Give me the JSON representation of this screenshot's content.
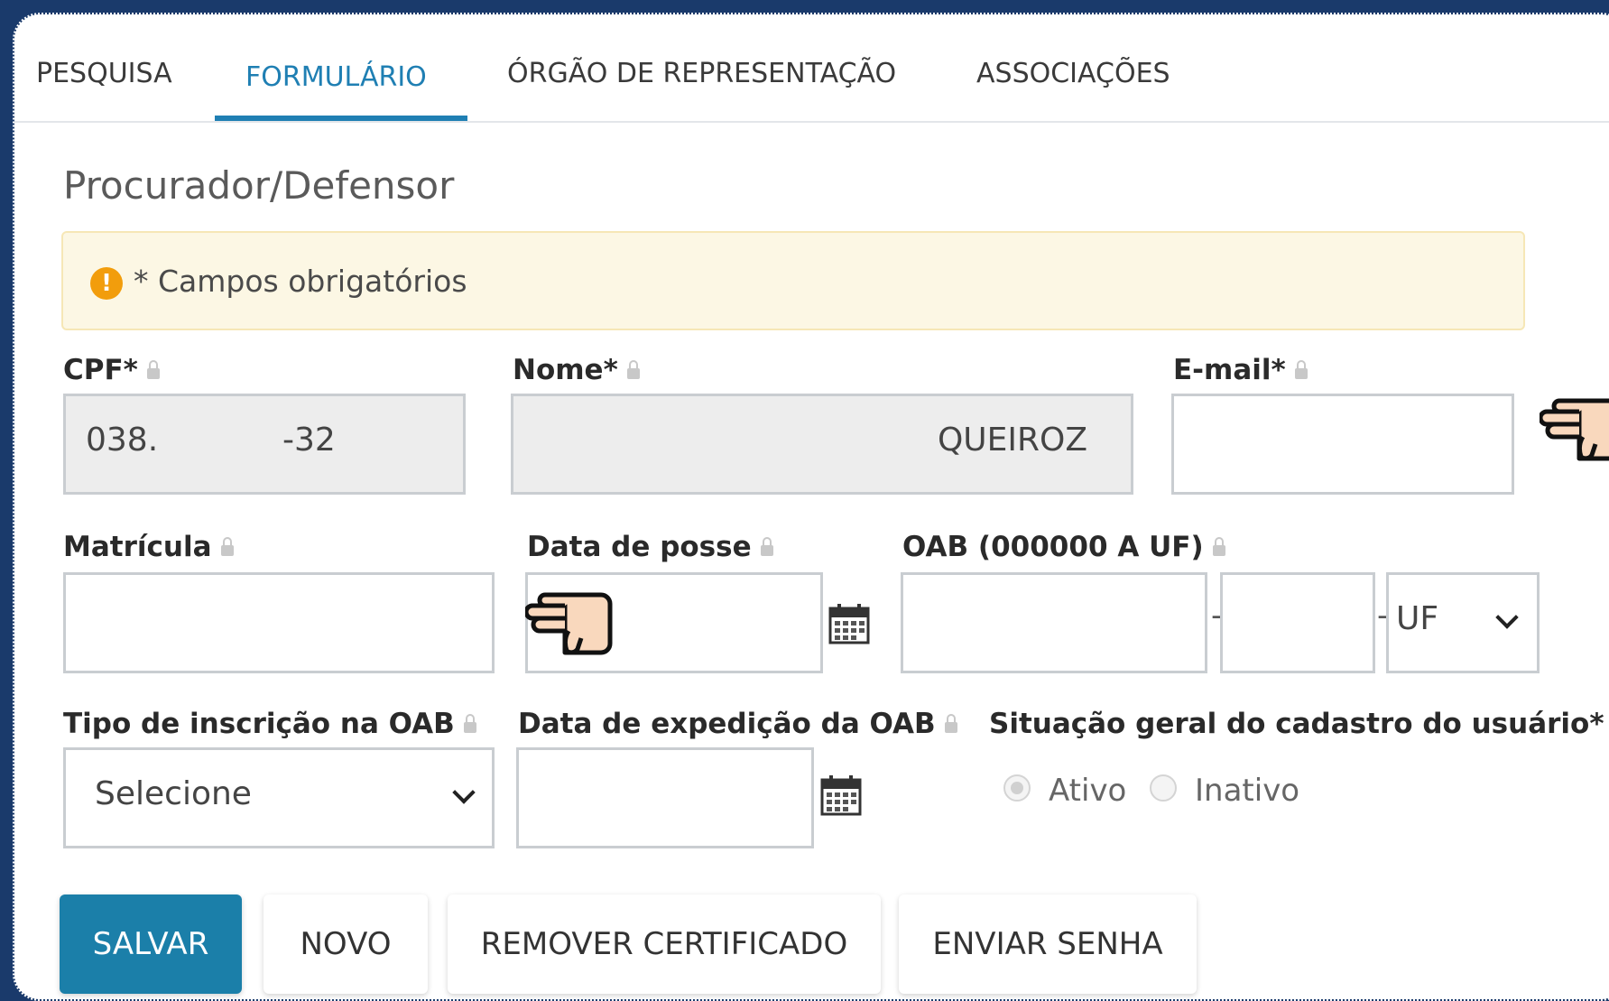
{
  "tabs": [
    {
      "label": "PESQUISA"
    },
    {
      "label": "FORMULÁRIO",
      "active": true
    },
    {
      "label": "ÓRGÃO DE REPRESENTAÇÃO"
    },
    {
      "label": "ASSOCIAÇÕES"
    }
  ],
  "page_title": "Procurador/Defensor",
  "alert": {
    "icon": "!",
    "text": "* Campos obrigatórios"
  },
  "form": {
    "cpf": {
      "label": "CPF*",
      "value_left": "038.",
      "value_right": "-32"
    },
    "nome": {
      "label": "Nome*",
      "value": "QUEIROZ"
    },
    "email": {
      "label": "E-mail*",
      "value": ""
    },
    "matricula": {
      "label": "Matrícula",
      "value": ""
    },
    "data_posse": {
      "label": "Data de posse",
      "value": ""
    },
    "oab": {
      "label": "OAB (000000 A UF)",
      "sep1": "-",
      "sep2": "-",
      "uf_selected": "UF"
    },
    "tipo_inscricao": {
      "label": "Tipo de inscrição na OAB",
      "selected": "Selecione"
    },
    "data_expedicao": {
      "label": "Data de expedição da OAB",
      "value": ""
    },
    "situacao": {
      "label": "Situação geral do cadastro do usuário*",
      "options": [
        {
          "label": "Ativo",
          "checked": true
        },
        {
          "label": "Inativo",
          "checked": false
        }
      ]
    }
  },
  "buttons": {
    "salvar": "SALVAR",
    "novo": "NOVO",
    "remover": "REMOVER CERTIFICADO",
    "enviar": "ENVIAR SENHA"
  },
  "colors": {
    "accent": "#1f7fb3",
    "primary_button": "#1b7fa9",
    "background": "#1a3a6b",
    "alert_bg": "#fcf7e4"
  }
}
